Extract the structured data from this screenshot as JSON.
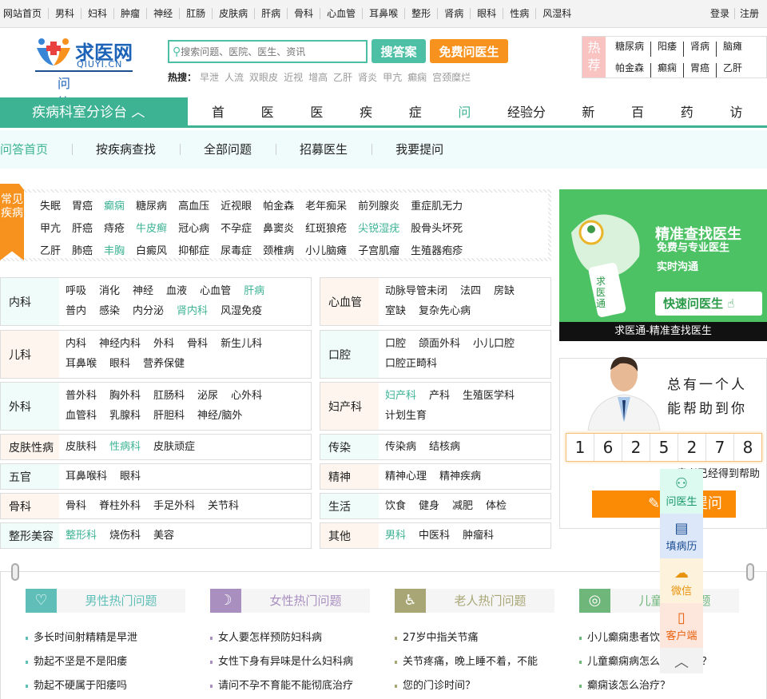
{
  "topbar": {
    "links": [
      "网站首页",
      "男科",
      "妇科",
      "肿瘤",
      "神经",
      "肛肠",
      "皮肤病",
      "肝病",
      "骨科",
      "心血管",
      "耳鼻喉",
      "整形",
      "肾病",
      "眼科",
      "性病",
      "风湿科"
    ],
    "login": "登录",
    "register": "注册"
  },
  "logo": {
    "name": "求医网",
    "en": "QIUYI.CN",
    "section": "问答"
  },
  "search": {
    "placeholder": "搜索问题、医院、医生、资讯",
    "search_btn": "搜答案",
    "ask_btn": "免费问医生",
    "hot_label": "热搜：",
    "hot": [
      "早泄",
      "人流",
      "双眼皮",
      "近视",
      "增高",
      "乙肝",
      "肾炎",
      "甲亢",
      "癫痫",
      "宫颈糜烂"
    ]
  },
  "hotbox": {
    "label": "热荐",
    "items": [
      "糖尿病",
      "阳痿",
      "肾病",
      "脑瘫",
      "帕金森",
      "癫痫",
      "胃癌",
      "乙肝"
    ]
  },
  "nav": {
    "dept": "疾病科室分诊台",
    "items": [
      "首页",
      "医院",
      "医生",
      "疾病",
      "症状",
      "问答",
      "经验分享",
      "新闻",
      "百科",
      "药品",
      "访谈"
    ],
    "active": 5
  },
  "subnav": {
    "items": [
      "问答首页",
      "按疾病查找",
      "全部问题",
      "招募医生",
      "我要提问"
    ],
    "active": 0
  },
  "common": {
    "label": "常见疾病",
    "items": [
      {
        "t": "失眠"
      },
      {
        "t": "胃癌"
      },
      {
        "t": "癫痫",
        "hl": 1
      },
      {
        "t": "糖尿病"
      },
      {
        "t": "高血压"
      },
      {
        "t": "近视眼"
      },
      {
        "t": "帕金森"
      },
      {
        "t": "老年痴呆"
      },
      {
        "t": "前列腺炎"
      },
      {
        "t": "重症肌无力"
      },
      {
        "t": "甲亢"
      },
      {
        "t": "肝癌"
      },
      {
        "t": "痔疮"
      },
      {
        "t": "牛皮癣",
        "hl": 1
      },
      {
        "t": "冠心病"
      },
      {
        "t": "不孕症"
      },
      {
        "t": "鼻窦炎"
      },
      {
        "t": "红斑狼疮"
      },
      {
        "t": "尖锐湿疣",
        "hl": 1
      },
      {
        "t": "股骨头坏死"
      },
      {
        "t": "乙肝"
      },
      {
        "t": "肺癌"
      },
      {
        "t": "丰胸",
        "hl": 1
      },
      {
        "t": "白癜风"
      },
      {
        "t": "抑郁症"
      },
      {
        "t": "尿毒症"
      },
      {
        "t": "颈椎病"
      },
      {
        "t": "小儿脑瘫"
      },
      {
        "t": "子宫肌瘤"
      },
      {
        "t": "生殖器疱疹"
      }
    ]
  },
  "departments": [
    {
      "cat": "内科",
      "items": [
        {
          "t": "呼吸"
        },
        {
          "t": "消化"
        },
        {
          "t": "神经"
        },
        {
          "t": "血液"
        },
        {
          "t": "心血管"
        },
        {
          "t": "肝病",
          "hl": 1
        },
        {
          "t": "普内"
        },
        {
          "t": "感染"
        },
        {
          "t": "内分泌"
        },
        {
          "t": "肾内科",
          "hl": 1
        },
        {
          "t": "风湿免疫"
        }
      ]
    },
    {
      "cat": "心血管",
      "items": [
        {
          "t": "动脉导管未闭"
        },
        {
          "t": "法四"
        },
        {
          "t": "房缺"
        },
        {
          "t": "室缺"
        },
        {
          "t": "复杂先心病"
        }
      ]
    },
    {
      "cat": "儿科",
      "items": [
        {
          "t": "内科"
        },
        {
          "t": "神经内科"
        },
        {
          "t": "外科"
        },
        {
          "t": "骨科"
        },
        {
          "t": "新生儿科"
        },
        {
          "t": "耳鼻喉"
        },
        {
          "t": "眼科"
        },
        {
          "t": "营养保健"
        }
      ]
    },
    {
      "cat": "口腔",
      "items": [
        {
          "t": "口腔"
        },
        {
          "t": "颌面外科"
        },
        {
          "t": "小儿口腔"
        },
        {
          "t": "口腔正畸科"
        }
      ]
    },
    {
      "cat": "外科",
      "items": [
        {
          "t": "普外科"
        },
        {
          "t": "胸外科"
        },
        {
          "t": "肛肠科"
        },
        {
          "t": "泌尿"
        },
        {
          "t": "心外科"
        },
        {
          "t": "血管科"
        },
        {
          "t": "乳腺科"
        },
        {
          "t": "肝胆科"
        },
        {
          "t": "神经/脑外"
        }
      ]
    },
    {
      "cat": "妇产科",
      "items": [
        {
          "t": "妇产科",
          "hl": 1
        },
        {
          "t": "产科"
        },
        {
          "t": "生殖医学科"
        },
        {
          "t": "计划生育"
        }
      ]
    },
    {
      "cat": "皮肤性病",
      "items": [
        {
          "t": "皮肤科"
        },
        {
          "t": "性病科",
          "hl": 1
        },
        {
          "t": "皮肤顽症"
        }
      ]
    },
    {
      "cat": "传染",
      "items": [
        {
          "t": "传染病"
        },
        {
          "t": "结核病"
        }
      ]
    },
    {
      "cat": "五官",
      "items": [
        {
          "t": "耳鼻喉科"
        },
        {
          "t": "眼科"
        }
      ]
    },
    {
      "cat": "精神",
      "items": [
        {
          "t": "精神心理"
        },
        {
          "t": "精神疾病"
        }
      ]
    },
    {
      "cat": "骨科",
      "items": [
        {
          "t": "骨科"
        },
        {
          "t": "脊柱外科"
        },
        {
          "t": "手足外科"
        },
        {
          "t": "关节科"
        }
      ]
    },
    {
      "cat": "生活",
      "items": [
        {
          "t": "饮食"
        },
        {
          "t": "健身"
        },
        {
          "t": "减肥"
        },
        {
          "t": "体检"
        }
      ]
    },
    {
      "cat": "整形美容",
      "items": [
        {
          "t": "整形科",
          "hl": 1
        },
        {
          "t": "烧伤科"
        },
        {
          "t": "美容"
        }
      ]
    },
    {
      "cat": "其他",
      "items": [
        {
          "t": "男科",
          "hl": 1
        },
        {
          "t": "中医科"
        },
        {
          "t": "肿瘤科"
        }
      ]
    }
  ],
  "ad": {
    "title": "精准查找医生",
    "line1": "免费与专业医生",
    "line2": "实时沟通",
    "button": "快速问医生",
    "footer": "求医通-精准查找医生",
    "phone_text": "求医通"
  },
  "doctor_box": {
    "slogan1": "总有一个人",
    "slogan2": "能帮助到你",
    "count": [
      "1",
      "6",
      "2",
      "5",
      "2",
      "7",
      "8"
    ],
    "helped": "患者已经得到帮助",
    "button": "马上提问"
  },
  "hot_questions": [
    {
      "title": "男性热门问题",
      "color": "#5fbfb8",
      "items": [
        "多长时间射精精是早泄",
        "勃起不坚是不是阳痿",
        "勃起不硬属于阳痿吗"
      ]
    },
    {
      "title": "女性热门问题",
      "color": "#a98fc0",
      "items": [
        "女人要怎样预防妇科病",
        "女性下身有异味是什么妇科病",
        "请问不孕不育能不能彻底治疗"
      ]
    },
    {
      "title": "老人热门问题",
      "color": "#a8a675",
      "items": [
        "27岁中指关节痛",
        "关节疼痛，晚上睡不着，不能",
        "您的门诊时间？"
      ]
    },
    {
      "title": "儿童热门问题",
      "color": "#6fb67b",
      "items": [
        "小儿癫痫患者饮食应该注",
        "儿童癫痫病怎么治好孩子？",
        "癫痫该怎么治疗？"
      ]
    }
  ],
  "float": {
    "items": [
      {
        "label": "问医生",
        "icon": "doctor-icon",
        "bg": "#dcfaf0",
        "color": "#17976a"
      },
      {
        "label": "填病历",
        "icon": "record-icon",
        "bg": "#dce8fa",
        "color": "#1d4f94"
      },
      {
        "label": "微信",
        "icon": "wechat-icon",
        "bg": "#fdf2dc",
        "color": "#e8930c"
      },
      {
        "label": "客户端",
        "icon": "phone-icon",
        "bg": "#fde6dc",
        "color": "#e8600c"
      }
    ]
  }
}
